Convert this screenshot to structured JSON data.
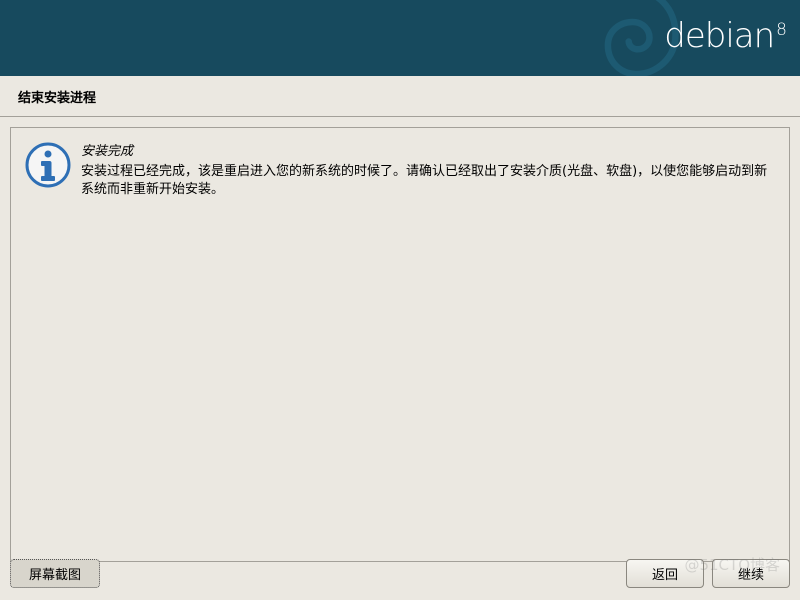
{
  "banner": {
    "brand": "debian",
    "version": "8"
  },
  "section_title": "结束安装进程",
  "message": {
    "title": "安装完成",
    "body": "安装过程已经完成，该是重启进入您的新系统的时候了。请确认已经取出了安装介质(光盘、软盘)，以使您能够启动到新系统而非重新开始安装。"
  },
  "buttons": {
    "screenshot": "屏幕截图",
    "back": "返回",
    "continue": "继续"
  },
  "watermark": "@51CTO博客"
}
